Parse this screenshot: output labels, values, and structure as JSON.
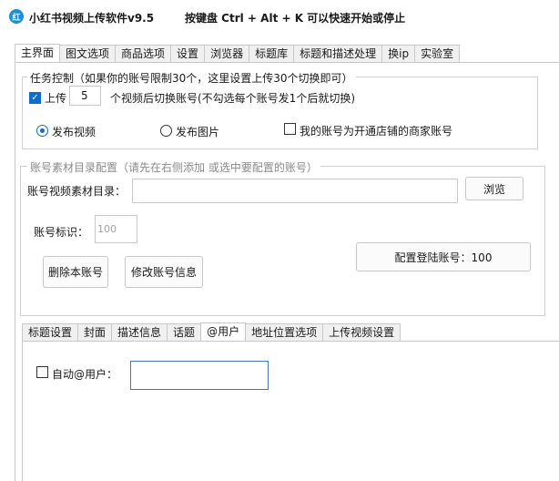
{
  "window": {
    "title": "小红书视频上传软件v9.5",
    "hint": "按键盘 Ctrl + Alt + K  可以快速开始或停止",
    "icon": "xiaohongshu-app-icon"
  },
  "main_tabs": [
    "主界面",
    "图文选项",
    "商品选项",
    "设置",
    "浏览器",
    "标题库",
    "标题和描述处理",
    "换ip",
    "实验室"
  ],
  "task": {
    "group_label": "任务控制（如果你的账号限制30个，这里设置上传30个切换即可）",
    "upload_check_label": "上传",
    "upload_count": "5",
    "upload_suffix": "个视频后切换账号(不勾选每个账号发1个后就切换)",
    "radio_video_label": "发布视频",
    "radio_image_label": "发布图片",
    "merchant_check_label": "我的账号为开通店铺的商家账号"
  },
  "account": {
    "group_label": "账号素材目录配置（请先在右侧添加 或选中要配置的账号）",
    "dir_label": "账号视频素材目录：",
    "dir_value": "",
    "browse_label": "浏览",
    "id_label": "账号标识：",
    "id_placeholder": "100",
    "config_label": "配置登陆账号：100",
    "delete_label": "删除本账号",
    "edit_label": "修改账号信息"
  },
  "sub_tabs": [
    "标题设置",
    "封面",
    "描述信息",
    "话题",
    "@用户",
    "地址位置选项",
    "上传视频设置"
  ],
  "mention": {
    "check_label": "自动@用户：",
    "value": ""
  }
}
